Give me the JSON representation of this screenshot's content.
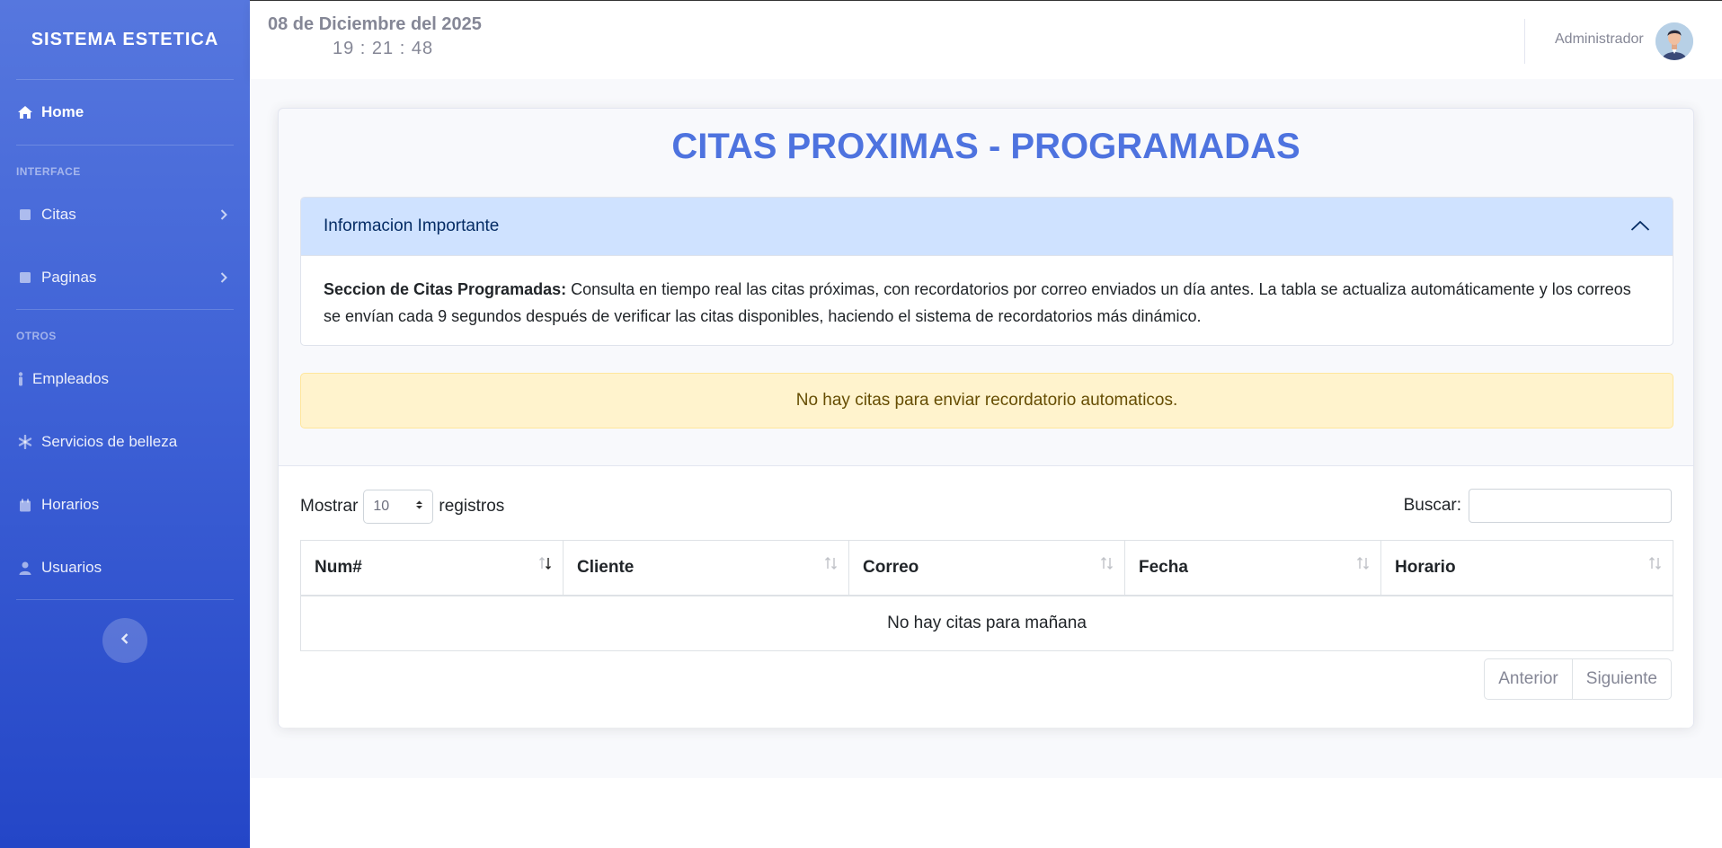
{
  "sidebar": {
    "brand": "SISTEMA ESTETICA",
    "home": "Home",
    "heading_interface": "INTERFACE",
    "heading_others": "OTROS",
    "items": {
      "citas": "Citas",
      "paginas": "Paginas",
      "empleados": "Empleados",
      "servicios": "Servicios de belleza",
      "horarios": "Horarios",
      "usuarios": "Usuarios"
    }
  },
  "topbar": {
    "date": "08 de Diciembre del 2025",
    "time": "19 : 21 : 48",
    "user": "Administrador"
  },
  "main": {
    "title": "CITAS PROXIMAS - PROGRAMADAS",
    "accordion": {
      "header": "Informacion Importante",
      "body_bold": "Seccion de Citas Programadas:",
      "body_text": " Consulta en tiempo real las citas próximas, con recordatorios por correo enviados un día antes. La tabla se actualiza automáticamente y los correos se envían cada 9 segundos después de verificar las citas disponibles, haciendo el sistema de recordatorios más dinámico."
    },
    "alert": "No hay citas para enviar recordatorio automaticos.",
    "table_controls": {
      "show_label": "Mostrar",
      "page_length": "10",
      "records_label": "registros",
      "search_label": "Buscar:"
    },
    "table": {
      "columns": [
        "Num#",
        "Cliente",
        "Correo",
        "Fecha",
        "Horario"
      ],
      "empty_message": "No hay citas para mañana"
    },
    "pagination": {
      "prev": "Anterior",
      "next": "Siguiente"
    }
  },
  "colors": {
    "primary": "#4e73df",
    "sidebar_top": "#5677de",
    "sidebar_bottom": "#2446c7",
    "accordion_header": "#cfe2ff",
    "alert_bg": "#fff3cd",
    "alert_text": "#664d03"
  },
  "icons": {
    "home": "home-icon",
    "citas": "book-icon",
    "paginas": "book-icon",
    "empleados": "person-icon",
    "servicios": "asterisk-icon",
    "horarios": "calendar-icon",
    "usuarios": "user-icon"
  }
}
